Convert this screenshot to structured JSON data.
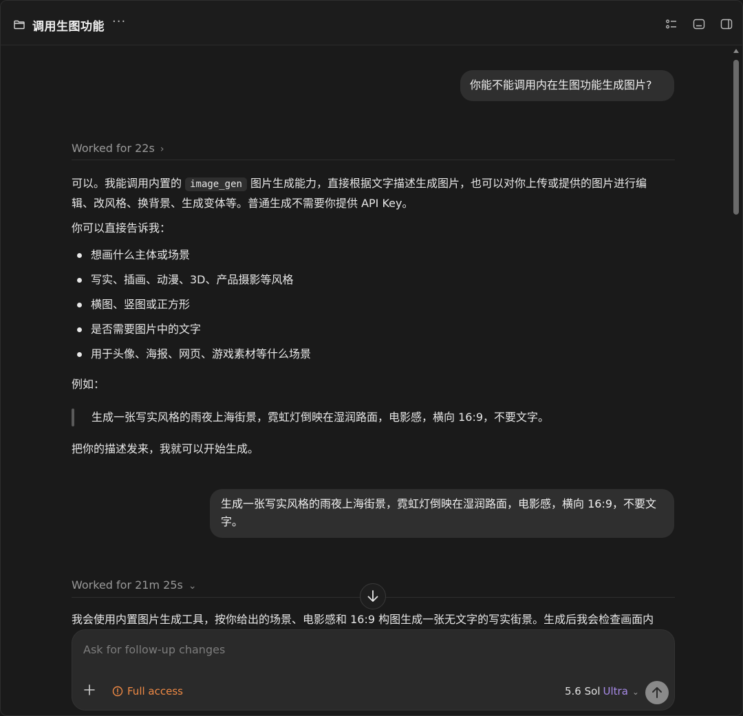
{
  "header": {
    "title": "调用生图功能",
    "more_label": "···"
  },
  "messages": {
    "user_1": "你能不能调用内在生图功能生成图片?",
    "worked_1": "Worked for 22s",
    "answer": {
      "p1_before": "可以。我能调用内置的 ",
      "p1_code": "image_gen",
      "p1_after_line1": " 图片生成能力，直接根据文字描述生成图片，也可以对你上传或提供的图片进行编",
      "p1_line2": "辑、改风格、换背景、生成变体等。普通生成不需要你提供 API Key。",
      "p2": "你可以直接告诉我：",
      "bullets": [
        "想画什么主体或场景",
        "写实、插画、动漫、3D、产品摄影等风格",
        "横图、竖图或正方形",
        "是否需要图片中的文字",
        "用于头像、海报、网页、游戏素材等什么场景"
      ],
      "p3": "例如：",
      "quote": "生成一张写实风格的雨夜上海街景，霓虹灯倒映在湿润路面，电影感，横向 16:9，不要文字。",
      "p4": "把你的描述发来，我就可以开始生成。"
    },
    "user_2": "生成一张写实风格的雨夜上海街景，霓虹灯倒映在湿润路面，电影感，横向 16:9，不要文字。",
    "worked_2": "Worked for 21m 25s",
    "answer_2_partial": "我会使用内置图片生成工具，按你给出的场景、电影感和 16:9 构图生成一张无文字的写实街景。生成后我会检查画面内"
  },
  "composer": {
    "placeholder": "Ask for follow-up changes",
    "access_label": "Full access",
    "model_name": "5.6 Sol",
    "model_tier": "Ultra"
  },
  "colors": {
    "accent_access": "#f08a45",
    "accent_tier": "#a88be8",
    "background": "#1a1a1a",
    "bubble": "#2f2f2f"
  },
  "icons": {
    "header_left": "folder-icon",
    "header_more": "more-icon",
    "header_right": [
      "checklist-icon",
      "terminal-panel-icon",
      "sidebar-toggle-icon"
    ],
    "composer": [
      "plus-icon",
      "warning-circle-icon",
      "chevron-down-icon",
      "arrow-up-icon"
    ],
    "scroll": "arrow-down-icon"
  }
}
